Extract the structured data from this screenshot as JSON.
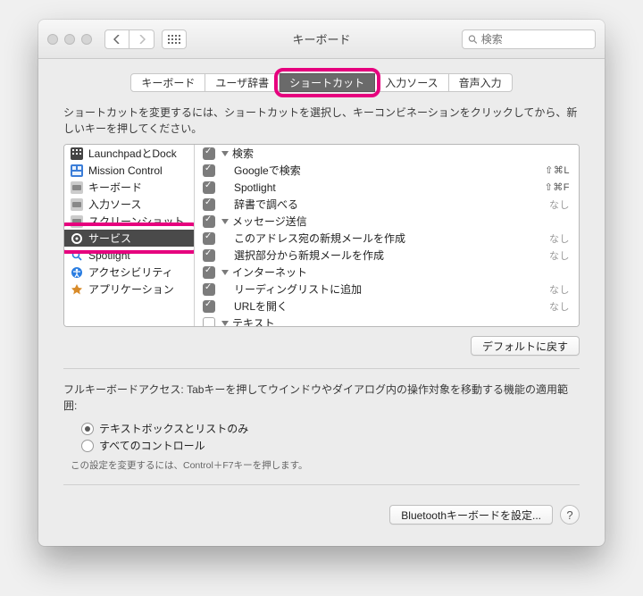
{
  "window": {
    "title": "キーボード"
  },
  "search": {
    "placeholder": "検索"
  },
  "tabs": [
    {
      "label": "キーボード"
    },
    {
      "label": "ユーザ辞書"
    },
    {
      "label": "ショートカット"
    },
    {
      "label": "入力ソース"
    },
    {
      "label": "音声入力"
    }
  ],
  "activeTab": 2,
  "instruction": "ショートカットを変更するには、ショートカットを選択し、キーコンビネーションをクリックしてから、新しいキーを押してください。",
  "categories": [
    {
      "label": "LaunchpadとDock",
      "icon": "launchpad"
    },
    {
      "label": "Mission Control",
      "icon": "mission"
    },
    {
      "label": "キーボード",
      "icon": "keyboard"
    },
    {
      "label": "入力ソース",
      "icon": "input"
    },
    {
      "label": "スクリーンショット",
      "icon": "screenshot"
    },
    {
      "label": "サービス",
      "icon": "gear"
    },
    {
      "label": "Spotlight",
      "icon": "spotlight"
    },
    {
      "label": "アクセシビリティ",
      "icon": "accessibility"
    },
    {
      "label": "アプリケーション",
      "icon": "app"
    }
  ],
  "selectedCategory": 5,
  "shortcuts": [
    {
      "type": "header",
      "checked": true,
      "label": "検索"
    },
    {
      "type": "item",
      "checked": true,
      "label": "Googleで検索",
      "shortcut": "⇧⌘L"
    },
    {
      "type": "item",
      "checked": true,
      "label": "Spotlight",
      "shortcut": "⇧⌘F"
    },
    {
      "type": "item",
      "checked": true,
      "label": "辞書で調べる",
      "shortcut_none": "なし"
    },
    {
      "type": "header",
      "checked": true,
      "label": "メッセージ送信"
    },
    {
      "type": "item",
      "checked": true,
      "label": "このアドレス宛の新規メールを作成",
      "shortcut_none": "なし"
    },
    {
      "type": "item",
      "checked": true,
      "label": "選択部分から新規メールを作成",
      "shortcut_none": "なし"
    },
    {
      "type": "header",
      "checked": true,
      "label": "インターネット"
    },
    {
      "type": "item",
      "checked": true,
      "label": "リーディングリストに追加",
      "shortcut_none": "なし"
    },
    {
      "type": "item",
      "checked": true,
      "label": "URLを開く",
      "shortcut_none": "なし"
    },
    {
      "type": "header",
      "checked": false,
      "label": "テキスト"
    }
  ],
  "defaultBtn": "デフォルトに戻す",
  "fullKeyboard": {
    "text": "フルキーボードアクセス: Tabキーを押してウインドウやダイアログ内の操作対象を移動する機能の適用範囲:",
    "opt1": "テキストボックスとリストのみ",
    "opt2": "すべてのコントロール",
    "note": "この設定を変更するには、Control＋F7キーを押します。"
  },
  "bluetoothBtn": "Bluetoothキーボードを設定..."
}
